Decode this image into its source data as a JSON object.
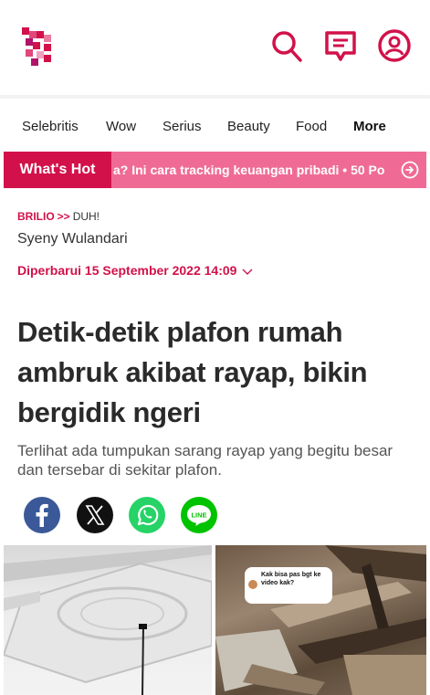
{
  "header": {
    "logo": "brilio-logo",
    "icons": [
      "search-icon",
      "chat-icon",
      "user-icon"
    ],
    "accent_color": "#d2114a"
  },
  "nav": {
    "items": [
      "Selebritis",
      "Wow",
      "Serius",
      "Beauty",
      "Food",
      "More"
    ]
  },
  "hot": {
    "label": "What's Hot",
    "ticker": "a? Ini cara tracking keuangan pribadi  • 50 Po"
  },
  "article": {
    "breadcrumb": {
      "brand": "BRILIO",
      "sep": ">>",
      "section": "DUH!"
    },
    "author": "Syeny Wulandari",
    "updated": "Diperbarui 15 September 2022 14:09",
    "title": "Detik-detik plafon rumah ambruk akibat rayap, bikin bergidik ngeri",
    "lede": "Terlihat ada tumpukan sarang rayap yang begitu besar dan tersebar di sekitar plafon."
  },
  "share": {
    "buttons": [
      {
        "name": "facebook",
        "icon": "facebook-icon",
        "color": "#3b5998"
      },
      {
        "name": "x",
        "icon": "x-icon",
        "color": "#111111"
      },
      {
        "name": "whatsapp",
        "icon": "whatsapp-icon",
        "color": "#25d366"
      },
      {
        "name": "line",
        "icon": "line-icon",
        "color": "#00c300"
      }
    ]
  },
  "media": {
    "comment": "Kak bisa pas bgt ke video kak?"
  }
}
